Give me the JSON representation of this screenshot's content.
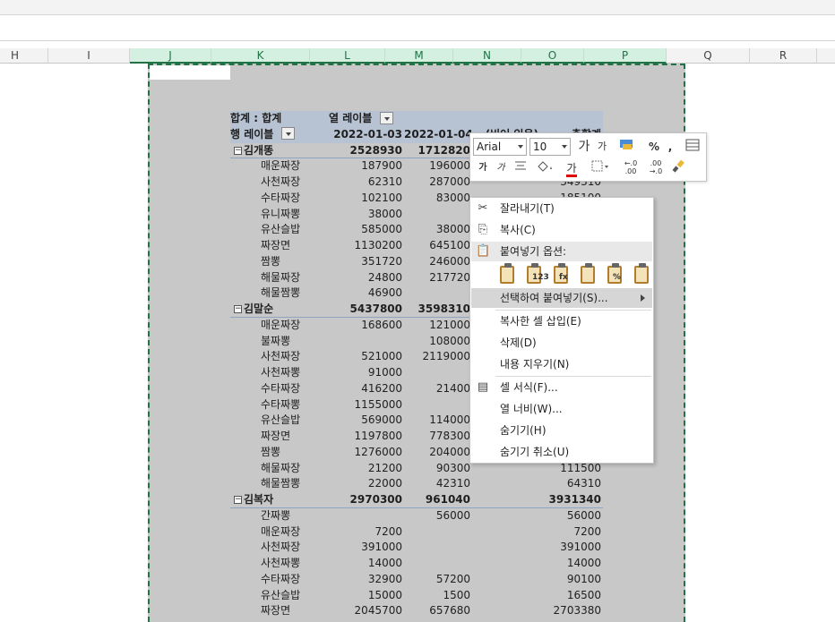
{
  "columns": [
    {
      "label": "H",
      "selected": false
    },
    {
      "label": "I",
      "selected": false
    },
    {
      "label": "J",
      "selected": true
    },
    {
      "label": "K",
      "selected": true
    },
    {
      "label": "L",
      "selected": true
    },
    {
      "label": "M",
      "selected": true
    },
    {
      "label": "N",
      "selected": true
    },
    {
      "label": "O",
      "selected": true
    },
    {
      "label": "P",
      "selected": true
    },
    {
      "label": "Q",
      "selected": false
    },
    {
      "label": "R",
      "selected": false
    }
  ],
  "pivot": {
    "header1": {
      "label": "합계 : 합계",
      "col_label": "열 레이블"
    },
    "header2": {
      "label": "행 레이블",
      "l": "2022-01-03",
      "m": "2022-01-04",
      "n": "(비어 있음)",
      "o": "총합계"
    },
    "rows": [
      {
        "type": "group",
        "label": "김개똥",
        "l": "2528930",
        "m": "1712820",
        "n": "",
        "o": ""
      },
      {
        "type": "child",
        "label": "매운짜장",
        "l": "187900",
        "m": "196000",
        "n": "",
        "o": ""
      },
      {
        "type": "child",
        "label": "사천짜장",
        "l": "62310",
        "m": "287000",
        "n": "",
        "o": "349310"
      },
      {
        "type": "child",
        "label": "수타짜장",
        "l": "102100",
        "m": "83000",
        "n": "",
        "o": "185100"
      },
      {
        "type": "child",
        "label": "유니짜뽕",
        "l": "38000",
        "m": "",
        "n": "",
        "o": ""
      },
      {
        "type": "child",
        "label": "유산슬밥",
        "l": "585000",
        "m": "38000",
        "n": "",
        "o": ""
      },
      {
        "type": "child",
        "label": "짜장면",
        "l": "1130200",
        "m": "645100",
        "n": "",
        "o": ""
      },
      {
        "type": "child",
        "label": "짬뽕",
        "l": "351720",
        "m": "246000",
        "n": "",
        "o": ""
      },
      {
        "type": "child",
        "label": "해물짜장",
        "l": "24800",
        "m": "217720",
        "n": "",
        "o": ""
      },
      {
        "type": "child",
        "label": "해물짬뽕",
        "l": "46900",
        "m": "",
        "n": "",
        "o": ""
      },
      {
        "type": "group",
        "label": "김말순",
        "l": "5437800",
        "m": "3598310",
        "n": "",
        "o": ""
      },
      {
        "type": "child",
        "label": "매운짜장",
        "l": "168600",
        "m": "121000",
        "n": "",
        "o": ""
      },
      {
        "type": "child",
        "label": "불짜뽕",
        "l": "",
        "m": "108000",
        "n": "",
        "o": ""
      },
      {
        "type": "child",
        "label": "사천짜장",
        "l": "521000",
        "m": "2119000",
        "n": "",
        "o": ""
      },
      {
        "type": "child",
        "label": "사천짜뽕",
        "l": "91000",
        "m": "",
        "n": "",
        "o": ""
      },
      {
        "type": "child",
        "label": "수타짜장",
        "l": "416200",
        "m": "21400",
        "n": "",
        "o": ""
      },
      {
        "type": "child",
        "label": "수타짜뽕",
        "l": "1155000",
        "m": "",
        "n": "",
        "o": ""
      },
      {
        "type": "child",
        "label": "유산슬밥",
        "l": "569000",
        "m": "114000",
        "n": "",
        "o": ""
      },
      {
        "type": "child",
        "label": "짜장면",
        "l": "1197800",
        "m": "778300",
        "n": "",
        "o": ""
      },
      {
        "type": "child",
        "label": "짬뽕",
        "l": "1276000",
        "m": "204000",
        "n": "",
        "o": ""
      },
      {
        "type": "child",
        "label": "해물짜장",
        "l": "21200",
        "m": "90300",
        "n": "",
        "o": "111500"
      },
      {
        "type": "child",
        "label": "해물짬뽕",
        "l": "22000",
        "m": "42310",
        "n": "",
        "o": "64310"
      },
      {
        "type": "group",
        "label": "김복자",
        "l": "2970300",
        "m": "961040",
        "n": "",
        "o": "3931340"
      },
      {
        "type": "child",
        "label": "간짜뽕",
        "l": "",
        "m": "56000",
        "n": "",
        "o": "56000"
      },
      {
        "type": "child",
        "label": "매운짜장",
        "l": "7200",
        "m": "",
        "n": "",
        "o": "7200"
      },
      {
        "type": "child",
        "label": "사천짜장",
        "l": "391000",
        "m": "",
        "n": "",
        "o": "391000"
      },
      {
        "type": "child",
        "label": "사천짜뽕",
        "l": "14000",
        "m": "",
        "n": "",
        "o": "14000"
      },
      {
        "type": "child",
        "label": "수타짜장",
        "l": "32900",
        "m": "57200",
        "n": "",
        "o": "90100"
      },
      {
        "type": "child",
        "label": "유산슬밥",
        "l": "15000",
        "m": "1500",
        "n": "",
        "o": "16500"
      },
      {
        "type": "child",
        "label": "짜장면",
        "l": "2045700",
        "m": "657680",
        "n": "",
        "o": "2703380"
      }
    ]
  },
  "mini_toolbar": {
    "font": "Arial",
    "size": "10",
    "grow": "가",
    "shrink": "가",
    "percent": "%",
    "comma": ",",
    "bold": "가",
    "italic": "가",
    "font_color": "가",
    "dec_inc": "←.0 .00",
    "dec_dec": ".00 →.0"
  },
  "context_menu": {
    "cut": "잘라내기(T)",
    "copy": "복사(C)",
    "paste_options": "붙여넣기 옵션:",
    "paste_special": "선택하여 붙여넣기(S)...",
    "insert_copied": "복사한 셀 삽입(E)",
    "delete": "삭제(D)",
    "clear": "내용 지우기(N)",
    "format_cells": "셀 서식(F)...",
    "col_width": "열 너비(W)...",
    "hide": "숨기기(H)",
    "unhide": "숨기기 취소(U)",
    "paste_sub": [
      "",
      "123",
      "fx",
      "",
      "%",
      ""
    ]
  },
  "colors": {
    "accent": "#217346",
    "selection_bg": "#c8c8c8",
    "pivot_header": "#b7c3d3"
  }
}
